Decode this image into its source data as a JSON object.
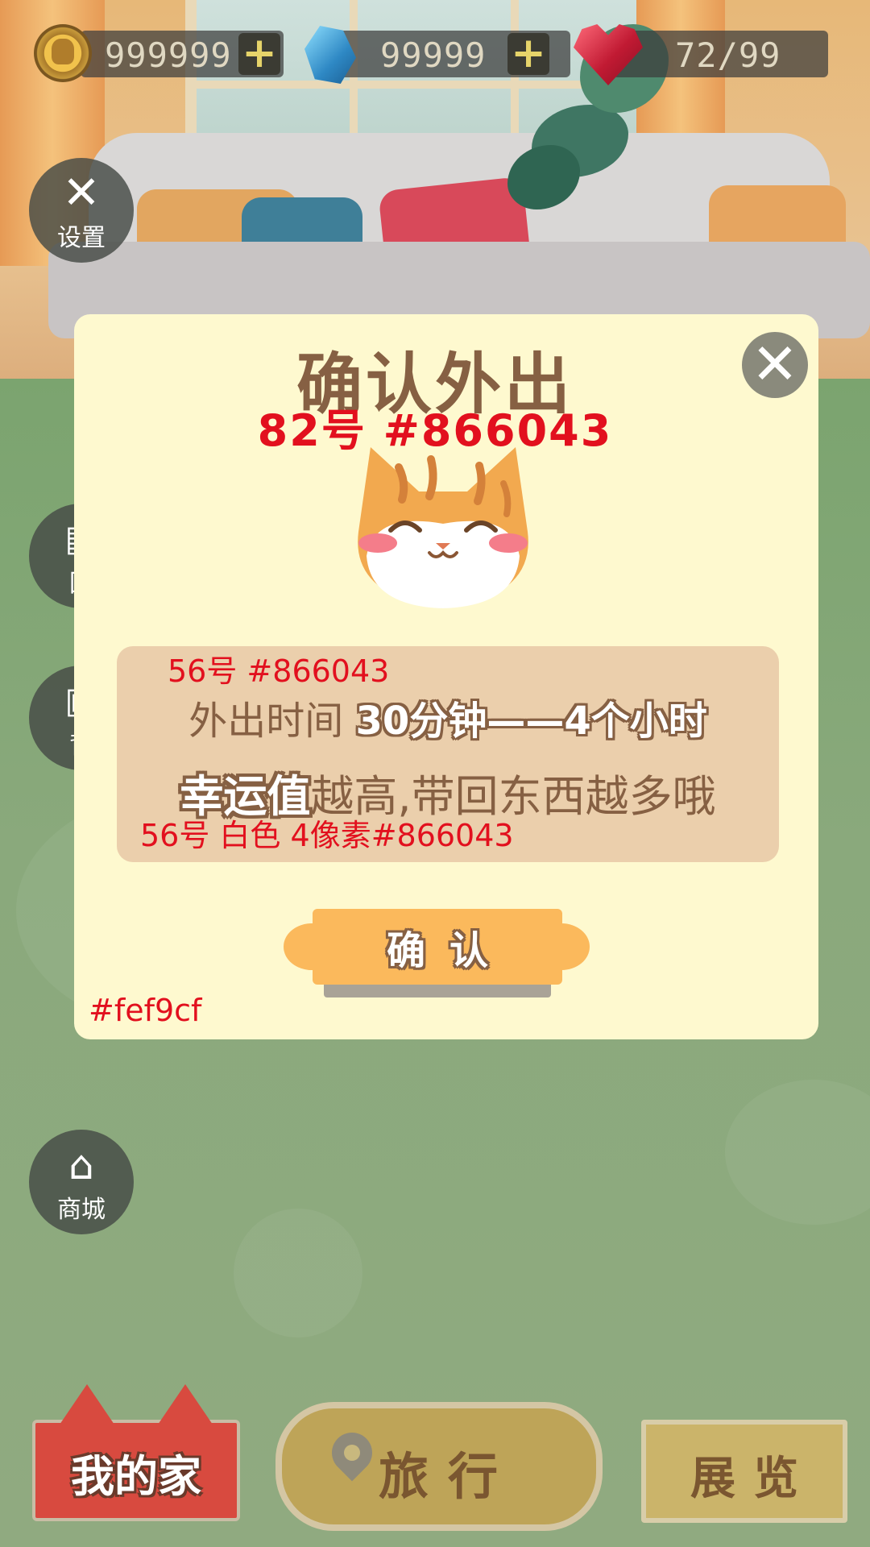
{
  "resources": {
    "coins": "999999",
    "gems": "99999",
    "hearts": "72/99",
    "add_symbol": "+"
  },
  "side_buttons": {
    "settings": "设置",
    "back_partial_1": "回",
    "back_partial_2": "背",
    "shop": "商城"
  },
  "dialog": {
    "title": "确认外出",
    "title_note": "82号  #866043",
    "line1_note": "56号  #866043",
    "line1_prefix": "外出时间 ",
    "line1_highlight": "30分钟——4个小时",
    "line2_highlight": "幸运值",
    "line2_rest": "越高,带回东西越多哦",
    "line2_note": "56号  白色  4像素#866043",
    "confirm_label": "确认",
    "bg_note": "#fef9cf",
    "close_symbol": "✕"
  },
  "bottom_nav": {
    "home": "我的家",
    "travel": "旅行",
    "exhibit": "展览"
  },
  "colors": {
    "dialog_bg": "#fef9cf",
    "text_brown": "#866043",
    "info_box": "#ebcfac",
    "confirm_button": "#fbb95c",
    "annotation_red": "#e2101e"
  }
}
